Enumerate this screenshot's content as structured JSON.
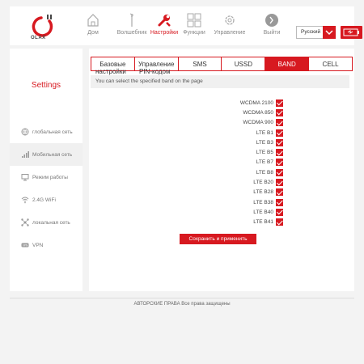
{
  "header": {
    "logo_text": "OLAX",
    "nav": [
      {
        "label": "Дом",
        "icon": "home-icon"
      },
      {
        "label": "Волшебник",
        "icon": "wand-icon"
      },
      {
        "label": "Настройки",
        "icon": "wrench-icon",
        "active": true
      },
      {
        "label": "Функции",
        "icon": "grid-icon"
      },
      {
        "label": "Управление",
        "icon": "gear-icon"
      },
      {
        "label": "Выйти",
        "icon": "power-icon"
      }
    ],
    "language": "Русский"
  },
  "sidebar": {
    "title": "Settings",
    "items": [
      {
        "label": "глобальная сеть",
        "icon": "globe-icon"
      },
      {
        "label": "Мобильная сеть",
        "icon": "signal-bars-icon",
        "active": true
      },
      {
        "label": "Режим работы",
        "icon": "monitor-icon"
      },
      {
        "label": "2.4G WiFi",
        "icon": "wifi-icon"
      },
      {
        "label": "локальная сеть",
        "icon": "network-icon"
      },
      {
        "label": "VPN",
        "icon": "vpn-icon"
      }
    ]
  },
  "main": {
    "tabs": [
      {
        "label": "Базовые",
        "overflow": "настройки"
      },
      {
        "label": "Управление",
        "overflow": "PIN-кодом"
      },
      {
        "label": "SMS"
      },
      {
        "label": "USSD"
      },
      {
        "label": "BAND",
        "active": true
      },
      {
        "label": "CELL"
      }
    ],
    "info_text": "You can select the specified band on the page",
    "bands": [
      {
        "label": "WCDMA 2100",
        "checked": true
      },
      {
        "label": "WCDMA 850",
        "checked": true
      },
      {
        "label": "WCDMA 900",
        "checked": true
      },
      {
        "label": "LTE B1",
        "checked": true
      },
      {
        "label": "LTE B3",
        "checked": true
      },
      {
        "label": "LTE B5",
        "checked": true
      },
      {
        "label": "LTE B7",
        "checked": true
      },
      {
        "label": "LTE B8",
        "checked": true
      },
      {
        "label": "LTE B20",
        "checked": true
      },
      {
        "label": "LTE B28",
        "checked": true
      },
      {
        "label": "LTE B38",
        "checked": true
      },
      {
        "label": "LTE B40",
        "checked": true
      },
      {
        "label": "LTE B41",
        "checked": true
      }
    ],
    "apply_label": "Сохранить и применить"
  },
  "footer": {
    "copyright": "АВТОРСКИЕ ПРАВА Все права защищены"
  },
  "colors": {
    "accent": "#d71920",
    "background": "#f3f3f3"
  }
}
